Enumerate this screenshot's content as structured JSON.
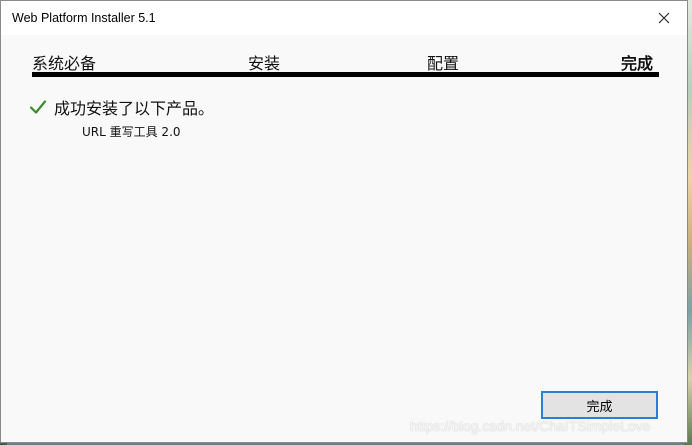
{
  "window": {
    "title": "Web Platform Installer 5.1",
    "close_icon": "close-icon"
  },
  "steps": [
    {
      "label": "系统必备",
      "active": false
    },
    {
      "label": "安装",
      "active": false
    },
    {
      "label": "配置",
      "active": false
    },
    {
      "label": "完成",
      "active": true
    }
  ],
  "result": {
    "status_icon": "check-icon",
    "status_color": "#3c8a2e",
    "message": "成功安装了以下产品。",
    "products": [
      "URL 重写工具 2.0"
    ]
  },
  "footer": {
    "finish_label": "完成",
    "accent_color": "#2a7fd4"
  },
  "watermark": "https://blog.csdn.net/ChaITSimpleLove"
}
